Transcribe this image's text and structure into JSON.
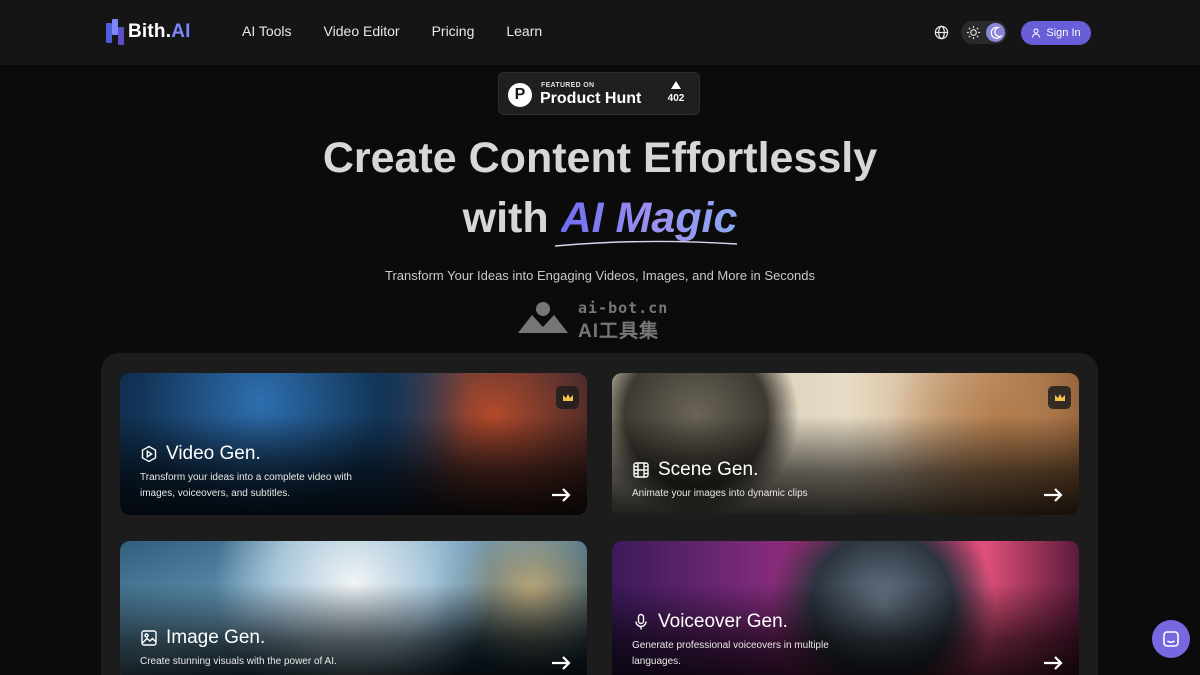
{
  "nav": {
    "logo_prefix": "Bith.",
    "logo_suffix": "AI",
    "links": [
      "AI Tools",
      "Video Editor",
      "Pricing",
      "Learn"
    ],
    "signin_label": "Sign In"
  },
  "product_hunt": {
    "featured": "FEATURED ON",
    "name": "Product Hunt",
    "votes": "402"
  },
  "hero": {
    "line1": "Create Content Effortlessly",
    "line2_prefix": "with",
    "line2_highlight": "AI Magic",
    "subtitle": "Transform Your Ideas into Engaging Videos, Images, and More in Seconds"
  },
  "watermark": {
    "line1": "ai-bot.cn",
    "line2": "AI工具集"
  },
  "cards": [
    {
      "title": "Video Gen.",
      "desc": "Transform your ideas into a complete video with images, voiceovers, and subtitles.",
      "icon": "play-hexagon-icon",
      "premium": true
    },
    {
      "title": "Scene Gen.",
      "desc": "Animate your images into dynamic clips",
      "icon": "film-icon",
      "premium": true
    },
    {
      "title": "Image Gen.",
      "desc": "Create stunning visuals with the power of AI.",
      "icon": "image-icon",
      "premium": false
    },
    {
      "title": "Voiceover Gen.",
      "desc": "Generate professional voiceovers in multiple languages.",
      "icon": "microphone-icon",
      "premium": false
    }
  ],
  "colors": {
    "accent": "#6a5ed8",
    "background": "#0b0b0c",
    "nav_background": "#151516",
    "panel": "#1c1c1d"
  }
}
